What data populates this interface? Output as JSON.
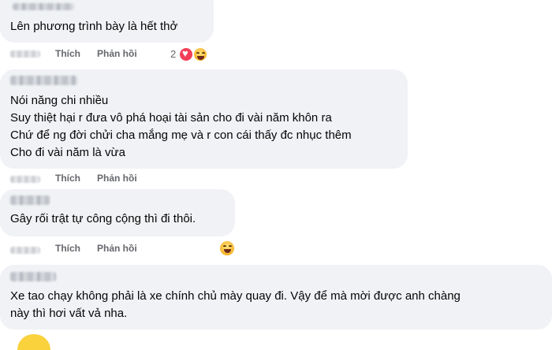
{
  "comments": [
    {
      "lines": [
        "Lên phương trình bày là hết thở"
      ]
    },
    {
      "lines": [
        "Nói năng chi nhiều",
        "Suy thiệt hại r đưa vô phá hoại tài sản cho đi vài năm khôn ra",
        "Chứ để ng đời chửi cha mắng mẹ và r con cái thấy đc nhục thêm",
        "Cho đi vài năm là vừa"
      ]
    },
    {
      "lines": [
        "Gây rối trật tự công cộng thì đi thôi."
      ]
    },
    {
      "lines": [
        "Xe tao chạy không phải là xe chính chủ mày quay đi. Vậy để mà mời được anh chàng",
        "này thì hơi vất vả nha."
      ]
    }
  ],
  "actions": {
    "like": "Thích",
    "reply": "Phản hồi"
  },
  "reactions": {
    "first_count": "2"
  },
  "icons": {
    "love": "heart-reaction-icon",
    "haha": "haha-reaction-icon"
  },
  "colors": {
    "bubble": "#f0f2f5",
    "secondary_text": "#65676b",
    "love": "#f33e58",
    "haha": "#f7b125"
  }
}
